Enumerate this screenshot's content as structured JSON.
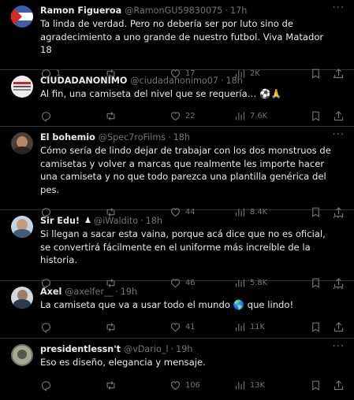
{
  "tweets": [
    {
      "name": "Ramon Figueroa",
      "handle": "@RamonGU59830075",
      "time": "17h",
      "badge": "",
      "text": "Ta linda de verdad. Pero no debería ser por luto sino de agradecimiento a uno grande de nuestro futbol. Viva Matador 18",
      "replies": "1",
      "retweets": "",
      "likes": "17",
      "views": "2K",
      "avatar_color": "#3b5fa8"
    },
    {
      "name": "CIUDADANONIMO",
      "handle": "@ciudadanonimo07",
      "time": "18h",
      "badge": "",
      "text": "Al fin, una camiseta del nivel que se requería… ⚽🙏",
      "replies": "",
      "retweets": "",
      "likes": "22",
      "views": "7.6K",
      "avatar_color": "#e8e8e8"
    },
    {
      "name": "El bohemio",
      "handle": "@Spec7roFilms",
      "time": "18h",
      "badge": "",
      "text": "Cómo sería de lindo dejar de trabajar con los dos monstruos de camisetas y volver a marcas que realmente les importe hacer una camiseta y no que todo parezca una plantilla genérica del pes.",
      "replies": "",
      "retweets": "",
      "likes": "44",
      "views": "8.4K",
      "avatar_color": "#6b5a4a"
    },
    {
      "name": "Sir Edu!",
      "handle": "@iWaldito",
      "time": "18h",
      "badge": "♟",
      "text": "Si llegan a sacar esta vaina, porque acá dice que no es oficial, se convertirá fácilmente en el uniforme más increíble de la historia.",
      "replies": "",
      "retweets": "",
      "likes": "46",
      "views": "5.8K",
      "avatar_color": "#7aa6c8"
    },
    {
      "name": "Axel",
      "handle": "@axelfer__",
      "time": "19h",
      "badge": "",
      "text": "La camiseta que va a usar todo el mundo 🌎 que lindo!",
      "replies": "",
      "retweets": "",
      "likes": "41",
      "views": "11K",
      "avatar_color": "#9aa7b2"
    },
    {
      "name": "presidentlessn't",
      "handle": "@vDario_l",
      "time": "19h",
      "badge": "",
      "text": "Eso es diseño, elegancia y mensaje.",
      "replies": "",
      "retweets": "",
      "likes": "106",
      "views": "13K",
      "avatar_color": "#8c8f7a"
    }
  ],
  "separator": "·",
  "more_glyph": "···",
  "colors": {
    "background": "#000000",
    "text": "#e7e9ea",
    "muted": "#71767b",
    "border": "#2f3336"
  }
}
